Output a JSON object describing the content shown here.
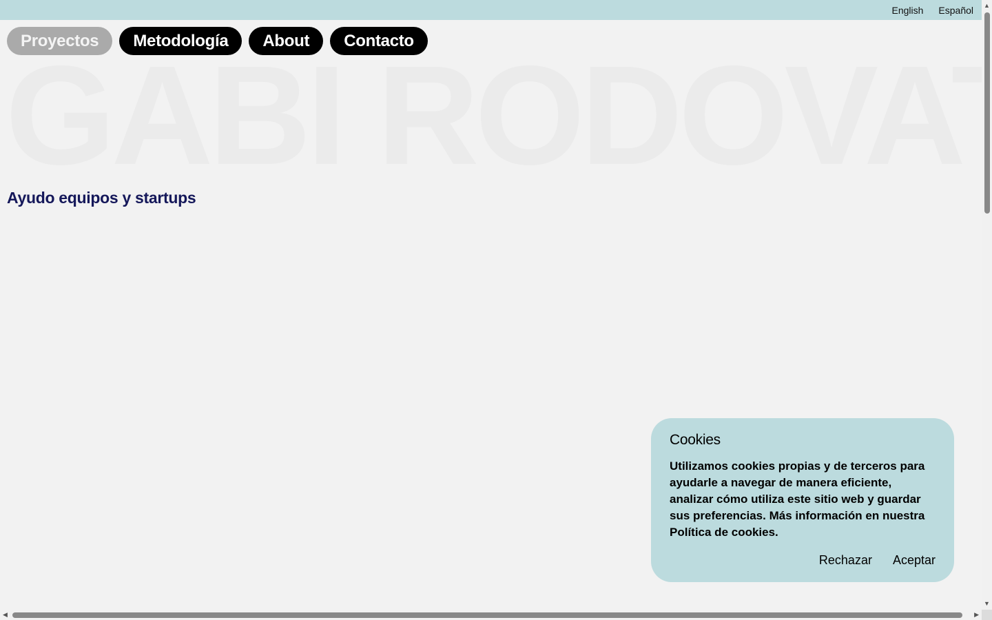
{
  "languages": {
    "english": "English",
    "spanish": "Español"
  },
  "nav": {
    "items": [
      {
        "label": "Proyectos",
        "active": true
      },
      {
        "label": "Metodología",
        "active": false
      },
      {
        "label": "About",
        "active": false
      },
      {
        "label": "Contacto",
        "active": false
      }
    ]
  },
  "hero": {
    "background_title": "GABI RODOVAT",
    "tagline": "Ayudo equipos y startups"
  },
  "cookie_banner": {
    "title": "Cookies",
    "text": "Utilizamos cookies propias y de terceros para ayudarle a navegar de manera eficiente, analizar cómo utiliza este sitio web y guardar sus preferencias. Más información en nuestra Política de cookies.",
    "reject_label": "Rechazar",
    "accept_label": "Aceptar"
  },
  "colors": {
    "background": "#f2f2f2",
    "topbar": "#bcdbde",
    "pill": "#000000",
    "pill_active": "#aaaaaa",
    "tagline": "#15185a",
    "bg_title": "#ebebeb"
  },
  "icons": {
    "scroll_up": "triangle-up-icon",
    "scroll_down": "triangle-down-icon",
    "scroll_left": "triangle-left-icon",
    "scroll_right": "triangle-right-icon"
  }
}
